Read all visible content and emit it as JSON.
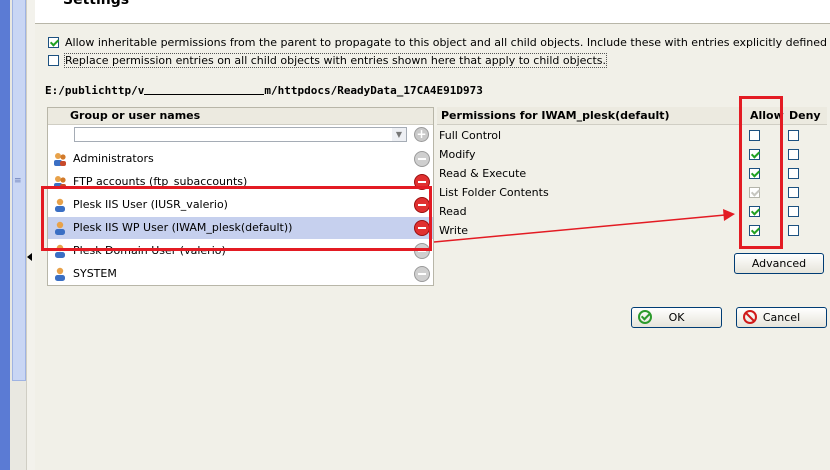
{
  "dialog": {
    "title": "Settings"
  },
  "options": {
    "inherit_label": "Allow inheritable permissions from the parent to propagate to this object and all child objects. Include these with entries explicitly defined here.",
    "inherit_checked": true,
    "replace_label": "Replace permission entries on all child objects with entries shown here that apply to child objects.",
    "replace_checked": false
  },
  "path": {
    "prefix": "E:/publichttp/v",
    "suffix": "m/httpdocs/ReadyData_17CA4E91D973"
  },
  "users": {
    "header": "Group or user names",
    "filter_value": "",
    "items": [
      {
        "label": "Administrators",
        "icon": "group-icon"
      },
      {
        "label": "FTP accounts (ftp_subaccounts)",
        "icon": "group-icon"
      },
      {
        "label": "Plesk IIS User (IUSR_valerio)",
        "icon": "user-icon"
      },
      {
        "label": "Plesk IIS WP User (IWAM_plesk(default))",
        "icon": "user-icon"
      },
      {
        "label": "Plesk Domain User (valerio)",
        "icon": "user-icon"
      },
      {
        "label": "SYSTEM",
        "icon": "user-icon"
      }
    ]
  },
  "permissions": {
    "header": "Permissions for IWAM_plesk(default)",
    "allow_label": "Allow",
    "deny_label": "Deny",
    "rows": [
      {
        "label": "Full Control",
        "allow": false,
        "deny": false
      },
      {
        "label": "Modify",
        "allow": true,
        "deny": false
      },
      {
        "label": "Read & Execute",
        "allow": true,
        "deny": false
      },
      {
        "label": "List Folder Contents",
        "allow": true,
        "deny": false,
        "allow_disabled": true
      },
      {
        "label": "Read",
        "allow": true,
        "deny": false
      },
      {
        "label": "Write",
        "allow": true,
        "deny": false
      }
    ],
    "advanced_label": "Advanced"
  },
  "buttons": {
    "ok_label": "OK",
    "cancel_label": "Cancel"
  },
  "colors": {
    "highlight": "#e31b23",
    "selection": "#c6d0ee",
    "check": "#21a121"
  }
}
